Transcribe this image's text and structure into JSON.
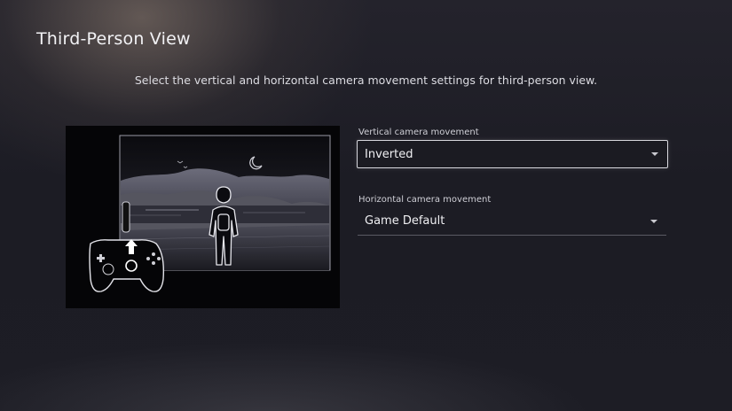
{
  "page": {
    "title": "Third-Person View",
    "subtitle": "Select the vertical and horizontal camera movement settings for third-person view."
  },
  "settings": {
    "vertical": {
      "label": "Vertical camera movement",
      "value": "Inverted",
      "focused": true
    },
    "horizontal": {
      "label": "Horizontal camera movement",
      "value": "Game Default",
      "focused": false
    }
  },
  "icons": {
    "dropdown": "chevron-down-icon",
    "illustration": "third-person-camera-illustration"
  },
  "colors": {
    "background": "#1d1d25",
    "text": "#f0f0f3",
    "focus_border": "#d8d8de"
  }
}
